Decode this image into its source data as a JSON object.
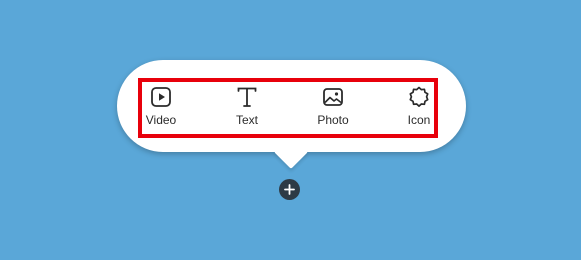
{
  "insert_menu": {
    "items": [
      {
        "label": "Video",
        "icon": "video-play-icon"
      },
      {
        "label": "Text",
        "icon": "text-t-icon"
      },
      {
        "label": "Photo",
        "icon": "photo-image-icon"
      },
      {
        "label": "Icon",
        "icon": "badge-icon"
      }
    ]
  },
  "colors": {
    "background": "#5aa7d8",
    "highlight": "#e8000b",
    "add_button": "#2d3a45"
  },
  "add_button": {
    "icon": "plus-icon"
  }
}
